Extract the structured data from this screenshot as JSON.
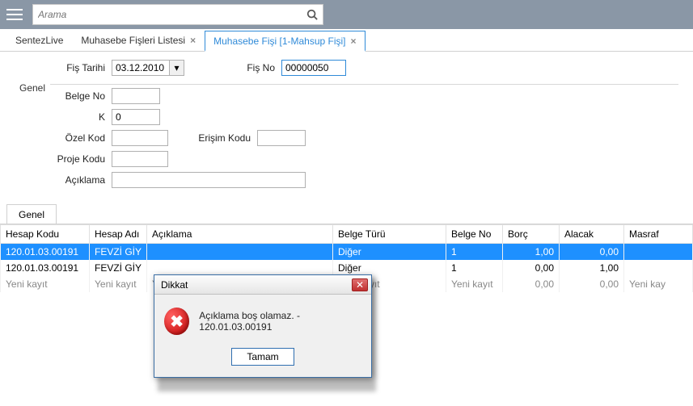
{
  "search": {
    "placeholder": "Arama"
  },
  "tabs": [
    {
      "label": "SentezLive"
    },
    {
      "label": "Muhasebe Fişleri Listesi"
    },
    {
      "label": "Muhasebe Fişi  [1-Mahsup Fişi]"
    }
  ],
  "form": {
    "fis_tarihi_label": "Fiş Tarihi",
    "fis_tarihi_value": "03.12.2010",
    "fis_no_label": "Fiş No",
    "fis_no_value": "00000050",
    "section_label": "Genel",
    "belge_no_label": "Belge No",
    "belge_no_value": "",
    "k_label": "K",
    "k_value": "0",
    "ozel_kod_label": "Özel Kod",
    "ozel_kod_value": "",
    "erisim_kodu_label": "Erişim Kodu",
    "erisim_kodu_value": "",
    "proje_kodu_label": "Proje Kodu",
    "proje_kodu_value": "",
    "aciklama_label": "Açıklama",
    "aciklama_value": ""
  },
  "subtab": {
    "label": "Genel"
  },
  "grid": {
    "headers": {
      "hesap_kodu": "Hesap Kodu",
      "hesap_adi": "Hesap Adı",
      "aciklama": "Açıklama",
      "belge_turu": "Belge Türü",
      "belge_no": "Belge No",
      "borc": "Borç",
      "alacak": "Alacak",
      "masraf": "Masraf"
    },
    "rows": [
      {
        "hesap_kodu": "120.01.03.00191",
        "hesap_adi": "FEVZİ GİY",
        "aciklama": "",
        "belge_turu": "Diğer",
        "belge_no": "1",
        "borc": "1,00",
        "alacak": "0,00",
        "masraf": ""
      },
      {
        "hesap_kodu": "120.01.03.00191",
        "hesap_adi": "FEVZİ GİY",
        "aciklama": "",
        "belge_turu": "Diğer",
        "belge_no": "1",
        "borc": "0,00",
        "alacak": "1,00",
        "masraf": ""
      },
      {
        "hesap_kodu": "Yeni kayıt",
        "hesap_adi": "Yeni kayıt",
        "aciklama": "Yeni kayıt",
        "belge_turu": "Yeni kayıt",
        "belge_no": "Yeni kayıt",
        "borc": "0,00",
        "alacak": "0,00",
        "masraf": "Yeni kay"
      }
    ]
  },
  "dialog": {
    "title": "Dikkat",
    "message": "Açıklama boş olamaz. - 120.01.03.00191",
    "ok": "Tamam"
  }
}
